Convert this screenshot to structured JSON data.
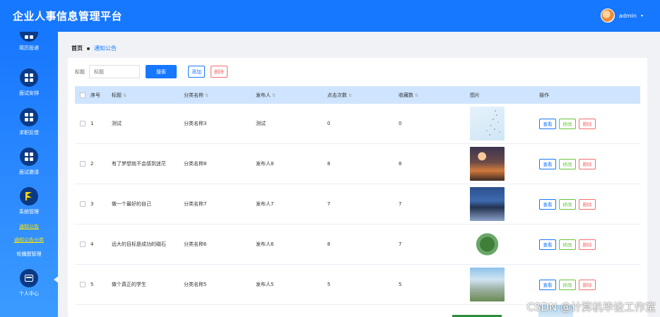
{
  "app": {
    "title": "企业人事信息管理平台"
  },
  "user": {
    "name": "admin",
    "caret": "▾"
  },
  "sidebar": {
    "items": [
      {
        "label": "简历投递",
        "icon": "grid-icon"
      },
      {
        "label": "面试安排",
        "icon": "grid-icon"
      },
      {
        "label": "求职反馈",
        "icon": "grid-icon"
      },
      {
        "label": "面试邀请",
        "icon": "grid-icon"
      },
      {
        "label": "系统管理",
        "icon": "flag-icon"
      },
      {
        "label": "个人中心",
        "icon": "wallet-icon"
      }
    ],
    "sub_items": [
      {
        "label": "通知公告",
        "state": "active"
      },
      {
        "label": "通知公告分类",
        "state": "hover"
      },
      {
        "label": "轮播图管理",
        "state": "normal"
      }
    ]
  },
  "breadcrumb": {
    "home": "首页",
    "current": "通知公告"
  },
  "search": {
    "label": "标题",
    "placeholder": "标题",
    "search_button": "搜索",
    "add_button": "添加",
    "delete_button": "删除"
  },
  "table": {
    "headers": {
      "index": "序号",
      "title": "标题",
      "category": "分类名称",
      "publisher": "发布人",
      "clicks": "点击次数",
      "favorites": "收藏数",
      "image": "图片",
      "actions": "操作"
    },
    "rows": [
      {
        "index": "1",
        "title": "测试",
        "category": "分类名称3",
        "publisher": "测试",
        "clicks": "0",
        "favorites": "0",
        "image": "sky-image"
      },
      {
        "index": "2",
        "title": "有了梦想就不会感到迷茫",
        "category": "分类名称8",
        "publisher": "发布人8",
        "clicks": "8",
        "favorites": "8",
        "image": "city-night-image"
      },
      {
        "index": "3",
        "title": "做一个最好的自己",
        "category": "分类名称7",
        "publisher": "发布人7",
        "clicks": "7",
        "favorites": "7",
        "image": "harbor-image"
      },
      {
        "index": "4",
        "title": "远大的目标是成功的磁石",
        "category": "分类名称6",
        "publisher": "发布人6",
        "clicks": "8",
        "favorites": "7",
        "image": "globe-image"
      },
      {
        "index": "5",
        "title": "做个真正的学生",
        "category": "分类名称5",
        "publisher": "发布人5",
        "clicks": "5",
        "favorites": "5",
        "image": "building-image"
      }
    ],
    "row_actions": {
      "view": "查看",
      "edit": "修改",
      "delete": "删除"
    }
  },
  "watermark": "CSDN @计算机毕设工作室",
  "colors": {
    "primary": "#1677ff",
    "header_row": "#cfe5ff",
    "success": "#67c23a",
    "danger": "#f56c6c",
    "menu_highlight": "#ffe600"
  }
}
